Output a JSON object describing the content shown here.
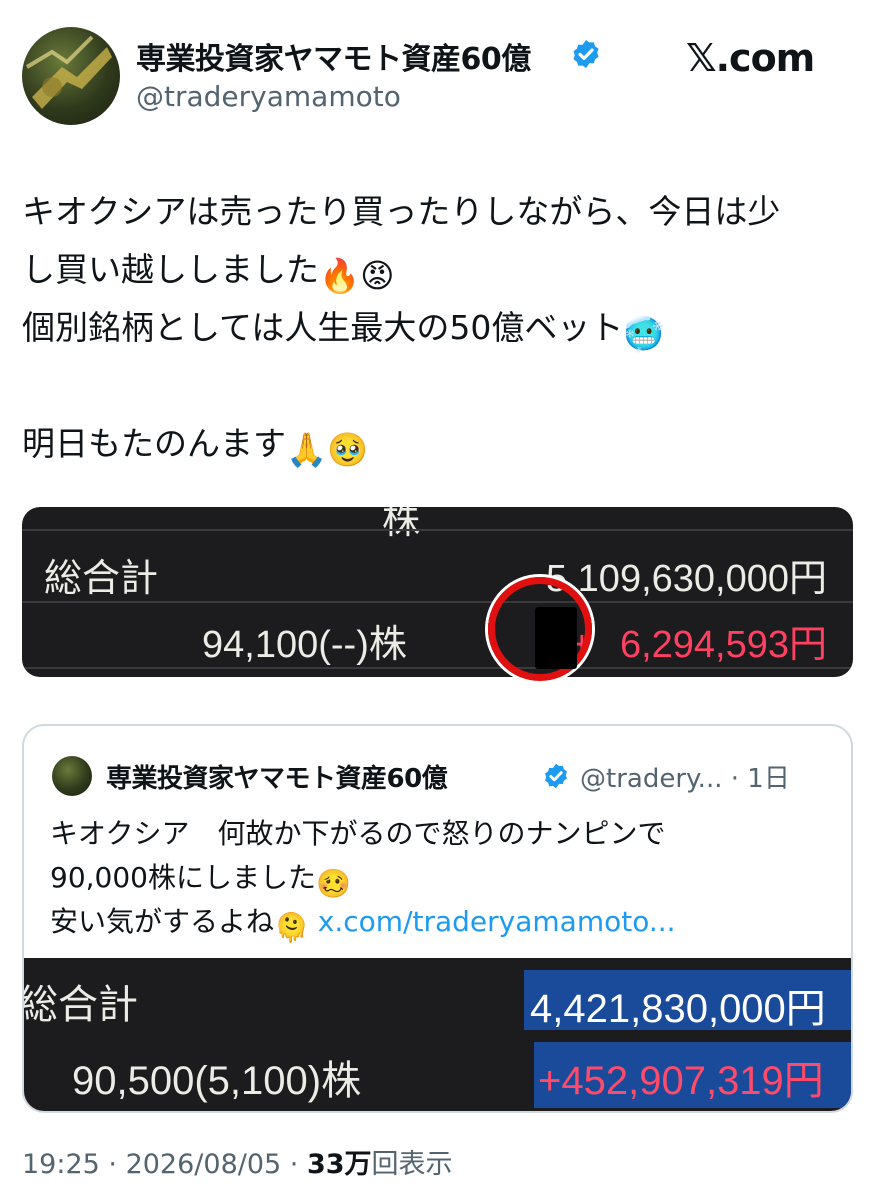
{
  "author": {
    "name": "専業投資家ヤマモト資産60億",
    "handle": "@traderyamamoto",
    "verified": true
  },
  "brand": {
    "site_label": "𝕏.com"
  },
  "tweet": {
    "lines": [
      "キオクシアは売ったり買ったりしながら、今日は少",
      "し買い越ししました",
      "個別銘柄としては人生最大の50億ベット",
      "",
      "明日もたのんます"
    ],
    "emojis": {
      "line2": [
        "🔥",
        "😡"
      ],
      "line3": [
        "🥶"
      ],
      "line5": [
        "🙏",
        "🥹"
      ]
    }
  },
  "main_image": {
    "top_cut_text": "株",
    "total_label": "総合計",
    "total_value": "5,109,630,000円",
    "shares": "94,100(--)株",
    "pl_prefix": "+",
    "pl_visible": "6",
    "pl_suffix": ",294,593円"
  },
  "quote": {
    "author_name": "専業投資家ヤマモト資産60億",
    "handle_time": "@tradery... · 1日",
    "lines": [
      "キオクシア　何故か下がるので怒りのナンピンで",
      "90,000株にしました",
      "安い気がするよね"
    ],
    "line2_emoji": "🥴",
    "line3_emoji": "🫠",
    "link": "x.com/traderyamamoto...",
    "image": {
      "total_label": "総合計",
      "total_value": "4,421,830,000円",
      "shares": "90,500(5,100)株",
      "pl": "+452,907,319円"
    }
  },
  "meta": {
    "time": "19:25",
    "date": "2026/08/05",
    "views_count": "33万",
    "views_label": "回表示"
  },
  "colors": {
    "text": "#0f1419",
    "secondary": "#536471",
    "link": "#1d9bf0",
    "verified": "#1d9bf0",
    "loss_red": "#ff4060"
  }
}
